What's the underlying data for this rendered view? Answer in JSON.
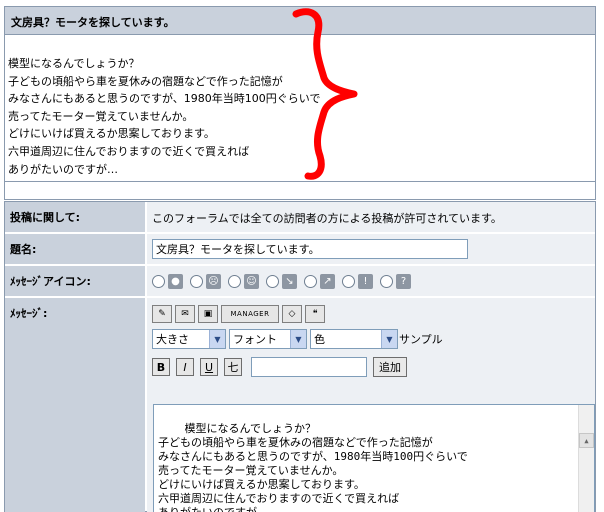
{
  "preview": {
    "title": "文房具？モータを探しています。",
    "lines": [
      "模型になるんでしょうか？",
      "子どもの頃船やら車を夏休みの宿題などで作った記憶が",
      "みなさんにもあると思うのですが、1980年当時100円ぐらいで",
      "売ってたモーター覚えていませんか。",
      "どけにいけば買えるか思案しております。",
      "六甲道周辺に住んでおりますので近くで買えれば",
      "ありがたいのですが…"
    ]
  },
  "form": {
    "posting_label": "投稿に関して:",
    "posting_text": "このフォーラムでは全ての訪問者の方による投稿が許可されています。",
    "subject_label": "題名:",
    "subject_value": "文房具？モータを探しています。",
    "icon_label": "ﾒｯｾｰｼﾞアイコン:",
    "message_label": "ﾒｯｾｰｼﾞ:",
    "manager_label": "MANAGER",
    "size_select": "大きさ",
    "font_select": "フォント",
    "color_select": "色",
    "sample_label": "サンプル",
    "bold": "B",
    "italic": "I",
    "underline": "U",
    "strike": "七",
    "add_button": "追加",
    "message_text": "模型になるんでしょうか？\n子どもの頃船やら車を夏休みの宿題などで作った記憶が\nみなさんにもあると思うのですが、1980年当時100円ぐらいで\n売ってたモーター覚えていませんか。\nどけにいけば買えるか思案しております。\n六甲道周辺に住んでおりますので近くで買えれば\nありがたいのですが..."
  },
  "colors": {
    "annotation": "#ff0000",
    "header_bg": "#c9d1dc"
  }
}
